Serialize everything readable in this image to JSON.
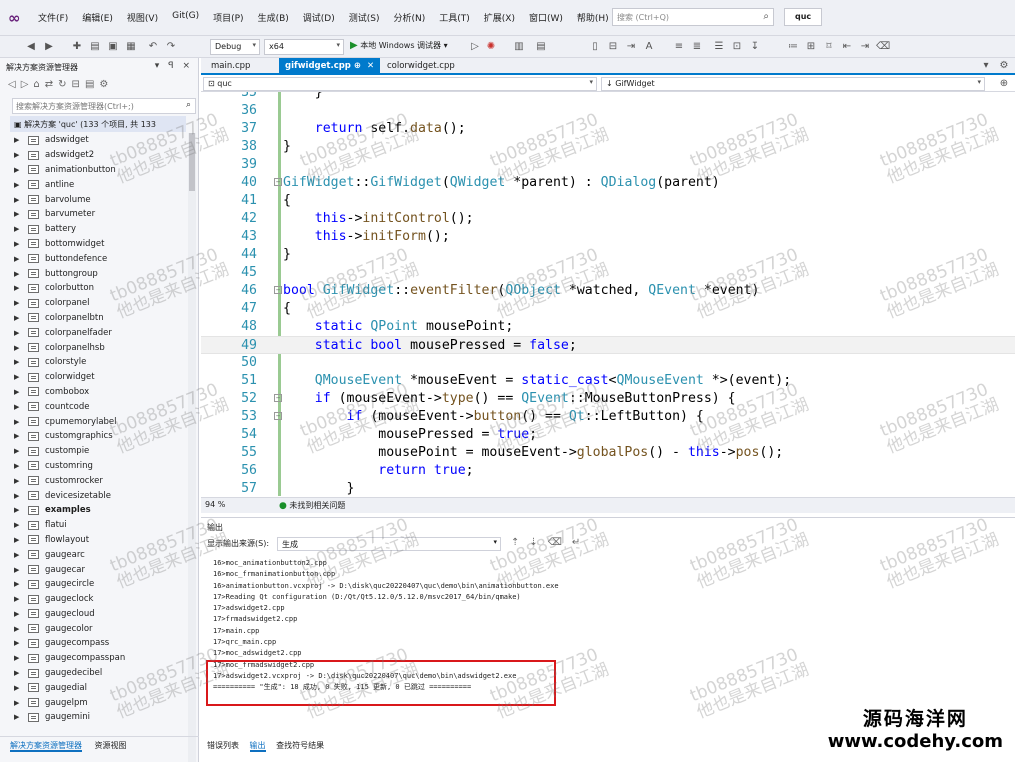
{
  "menubar": {
    "items": [
      "文件(F)",
      "编辑(E)",
      "视图(V)",
      "Git(G)",
      "项目(P)",
      "生成(B)",
      "调试(D)",
      "测试(S)",
      "分析(N)",
      "工具(T)",
      "扩展(X)",
      "窗口(W)",
      "帮助(H)"
    ],
    "search_placeholder": "搜索 (Ctrl+Q)",
    "solution_name": "quc"
  },
  "toolbar": {
    "configuration": "Debug",
    "platform": "x64",
    "run_label": "本地 Windows 调试器"
  },
  "solution_explorer": {
    "title": "解决方案资源管理器",
    "title_buttons": "▾ ꟼ ×",
    "search_placeholder": "搜索解决方案资源管理器(Ctrl+;)",
    "root_label": "解决方案 'quc' (133 个项目, 共 133",
    "items": [
      "adswidget",
      "adswidget2",
      "animationbutton",
      "antline",
      "barvolume",
      "barvumeter",
      "battery",
      "bottomwidget",
      "buttondefence",
      "buttongroup",
      "colorbutton",
      "colorpanel",
      "colorpanelbtn",
      "colorpanelfader",
      "colorpanelhsb",
      "colorstyle",
      "colorwidget",
      "combobox",
      "countcode",
      "cpumemorylabel",
      "customgraphics",
      "custompie",
      "customring",
      "customrocker",
      "devicesizetable",
      "examples",
      "flatui",
      "flowlayout",
      "gaugearc",
      "gaugecar",
      "gaugecircle",
      "gaugeclock",
      "gaugecloud",
      "gaugecolor",
      "gaugecompass",
      "gaugecompasspan",
      "gaugedecibel",
      "gaugedial",
      "gaugelpm",
      "gaugemini"
    ],
    "bold_item": "examples",
    "bottom_tabs": [
      "解决方案资源管理器",
      "资源视图"
    ]
  },
  "editor": {
    "tabs": [
      "main.cpp",
      "gifwidget.cpp",
      "colorwidget.cpp"
    ],
    "active_tab": "gifwidget.cpp",
    "nav_left": "quc",
    "nav_right": "GifWidget",
    "zoom": "94 %",
    "issues_label": "未找到相关问题",
    "lines": [
      {
        "n": "35",
        "t": "    }"
      },
      {
        "n": "36",
        "t": ""
      },
      {
        "n": "37",
        "t": "    return self.data();"
      },
      {
        "n": "38",
        "t": "}"
      },
      {
        "n": "39",
        "t": ""
      },
      {
        "n": "40",
        "t": "GifWidget::GifWidget(QWidget *parent) : QDialog(parent)"
      },
      {
        "n": "41",
        "t": "{"
      },
      {
        "n": "42",
        "t": "    this->initControl();"
      },
      {
        "n": "43",
        "t": "    this->initForm();"
      },
      {
        "n": "44",
        "t": "}"
      },
      {
        "n": "45",
        "t": ""
      },
      {
        "n": "46",
        "t": "bool GifWidget::eventFilter(QObject *watched, QEvent *event)"
      },
      {
        "n": "47",
        "t": "{"
      },
      {
        "n": "48",
        "t": "    static QPoint mousePoint;"
      },
      {
        "n": "49",
        "t": "    static bool mousePressed = false;"
      },
      {
        "n": "50",
        "t": ""
      },
      {
        "n": "51",
        "t": "    QMouseEvent *mouseEvent = static_cast<QMouseEvent *>(event);"
      },
      {
        "n": "52",
        "t": "    if (mouseEvent->type() == QEvent::MouseButtonPress) {"
      },
      {
        "n": "53",
        "t": "        if (mouseEvent->button() == Qt::LeftButton) {"
      },
      {
        "n": "54",
        "t": "            mousePressed = true;"
      },
      {
        "n": "55",
        "t": "            mousePoint = mouseEvent->globalPos() - this->pos();"
      },
      {
        "n": "56",
        "t": "            return true;"
      },
      {
        "n": "57",
        "t": "        }"
      }
    ]
  },
  "output": {
    "title": "输出",
    "source_label": "显示输出来源(S):",
    "source_value": "生成",
    "lines": [
      "16>moc_animationbutton2.cpp",
      "16>moc_frmanimationbutton.cpp",
      "16>animationbutton.vcxproj -> D:\\disk\\quc20220407\\quc\\demo\\bin\\animationbutton.exe",
      "17>Reading Qt configuration (D:/Qt/Qt5.12.0/5.12.0/msvc2017_64/bin/qmake)",
      "17>adswidget2.cpp",
      "17>frmadswidget2.cpp",
      "17>main.cpp",
      "17>qrc_main.cpp",
      "17>moc_adswidget2.cpp",
      "17>moc_frmadswidget2.cpp",
      "17>adswidget2.vcxproj -> D:\\disk\\quc20220407\\quc\\demo\\bin\\adswidget2.exe",
      "========== \"生成\": 18 成功, 0 失败, 115 更新, 0 已跳过 =========="
    ],
    "bottom_tabs": [
      "错误列表",
      "输出",
      "查找符号结果"
    ],
    "active_bottom_tab": "输出"
  },
  "watermark": {
    "id": "tb088857730",
    "slogan": "他也是来自江湖",
    "site_cn": "源码海洋网",
    "site_url": "www.codehy.com"
  }
}
